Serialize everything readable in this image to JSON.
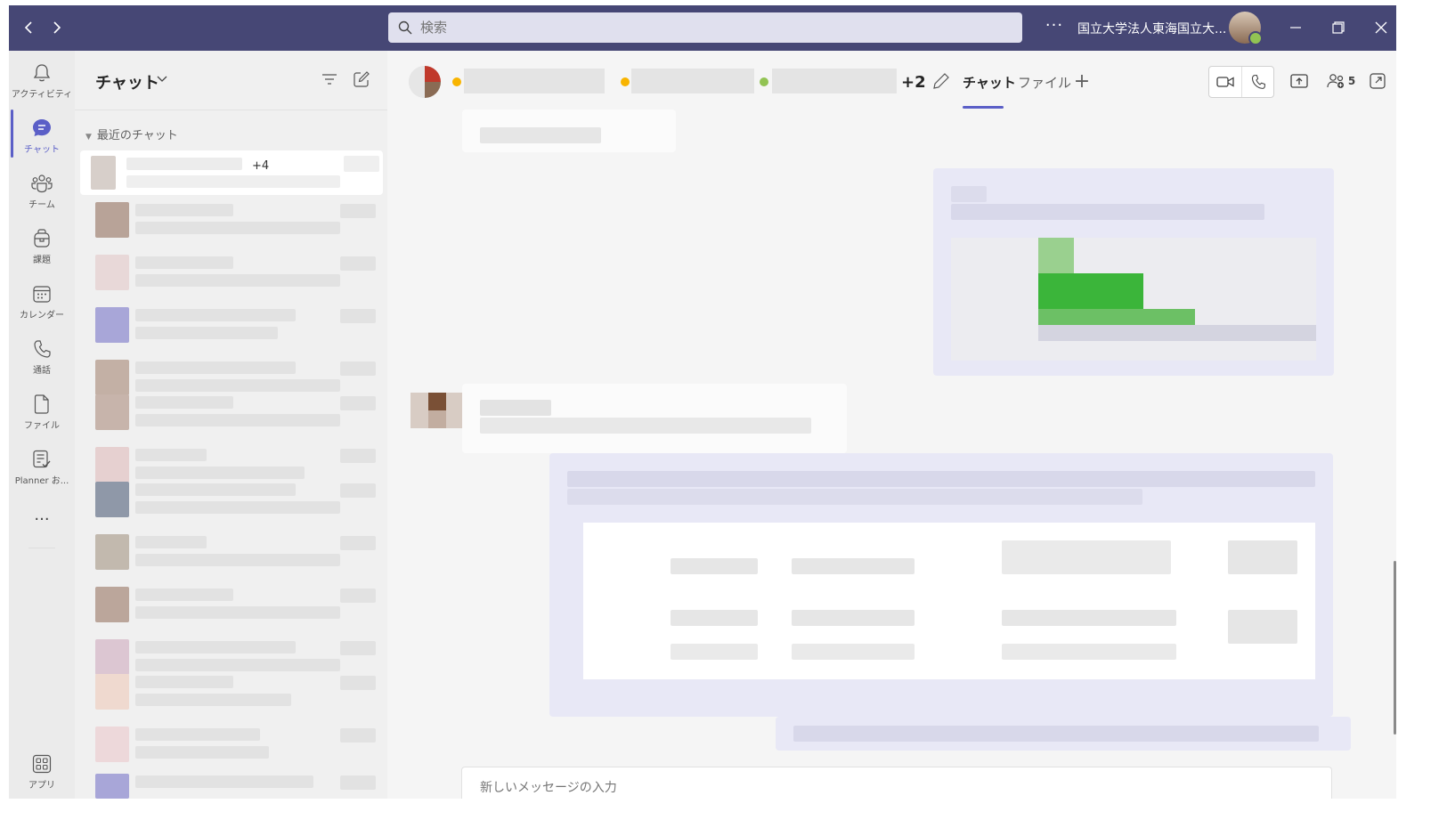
{
  "app": {
    "search_placeholder": "検索",
    "more": "···",
    "org_name": "国立大学法人東海国立大...",
    "colors": {
      "titlebar": "#464775",
      "accent": "#5b5fc7",
      "presence_available": "#92c353",
      "presence_away": "#f8b400"
    }
  },
  "rail": {
    "items": [
      {
        "label": "アクティビティ",
        "icon": "bell-icon"
      },
      {
        "label": "チャット",
        "icon": "chat-icon"
      },
      {
        "label": "チーム",
        "icon": "teams-icon"
      },
      {
        "label": "課題",
        "icon": "assignments-icon"
      },
      {
        "label": "カレンダー",
        "icon": "calendar-icon"
      },
      {
        "label": "通話",
        "icon": "phone-icon"
      },
      {
        "label": "ファイル",
        "icon": "file-icon"
      },
      {
        "label": "Planner お...",
        "icon": "planner-icon"
      },
      {
        "label": "アプリ",
        "icon": "apps-icon"
      }
    ],
    "more": "···"
  },
  "chatlist": {
    "title": "チャット",
    "section": "最近のチャット",
    "first_badge": "+4"
  },
  "chat": {
    "extra_members": "+2",
    "tabs": [
      {
        "label": "チャット"
      },
      {
        "label": "ファイル"
      }
    ],
    "add_tab": "+",
    "participants_count": "5",
    "composer_placeholder": "新しいメッセージの入力"
  }
}
